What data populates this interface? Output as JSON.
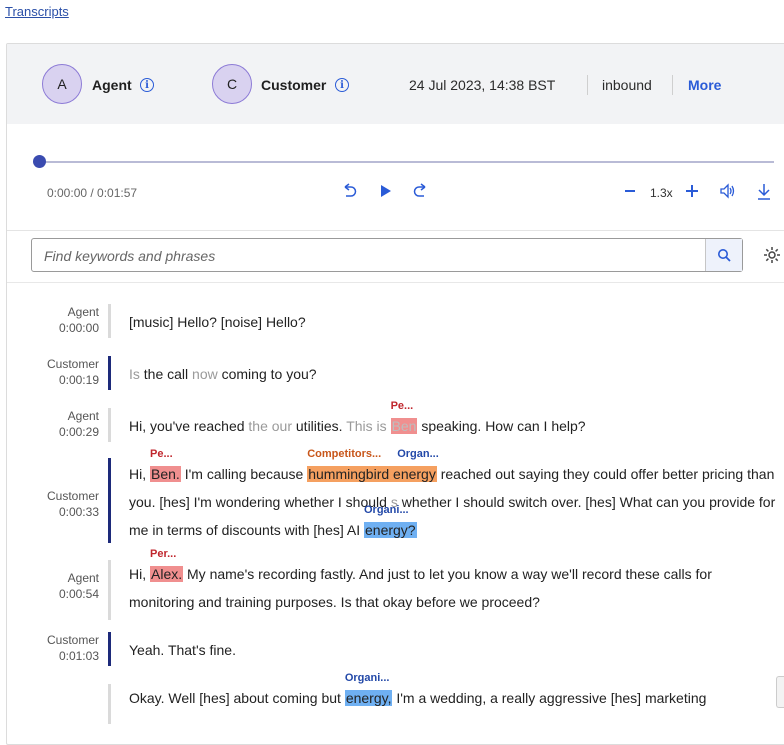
{
  "breadcrumb": "Transcripts",
  "header": {
    "agent": {
      "initial": "A",
      "name": "Agent"
    },
    "customer": {
      "initial": "C",
      "name": "Customer"
    },
    "datetime": "24 Jul 2023, 14:38 BST",
    "direction": "inbound",
    "more_label": "More"
  },
  "player": {
    "time": "0:00:00 / 0:01:57",
    "speed": "1.3x",
    "progress": 0
  },
  "search": {
    "placeholder": "Find keywords and phrases"
  },
  "transcript": [
    {
      "speaker": "Agent",
      "time": "0:00:00"
    },
    {
      "speaker": "Customer",
      "time": "0:00:19"
    },
    {
      "speaker": "Agent",
      "time": "0:00:29"
    },
    {
      "speaker": "Customer",
      "time": "0:00:33"
    },
    {
      "speaker": "Agent",
      "time": "0:00:54"
    },
    {
      "speaker": "Customer",
      "time": "0:01:03"
    }
  ],
  "utterances": {
    "u1": "[music] Hello? [noise] Hello?",
    "u2": {
      "a": "Is",
      "b": " the call ",
      "c": "now",
      "d": " coming to you?"
    },
    "u3": {
      "a": "Hi, you've reached ",
      "b": "the our",
      "c": " utilities. ",
      "d": "This is",
      "e": " ",
      "ent": "Ben",
      "tag": "Pe...",
      "f": " speaking. How can I help?"
    },
    "u4": {
      "a": "Hi, ",
      "ent1": "Ben.",
      "tag1": "Pe...",
      "b": " I'm calling because ",
      "ent2": "hummingbird energy",
      "tag2": "Competitors...",
      "tag2b": "Organ...",
      "c": " reached out saying they could offer better pricing than you. [hes] I'm wondering whether I should ",
      "d": "s",
      "e": " whether I should switch over. [hes] What can you provide for me in terms of discounts with [hes] AI ",
      "ent3": "energy?",
      "tag3": "Organi..."
    },
    "u5": {
      "a": "Hi, ",
      "ent": "Alex.",
      "tag": "Per...",
      "b": " My name's recording fastly. And just to let you know a way we'll record these calls for monitoring and training purposes. Is that okay before we proceed?"
    },
    "u6": "Yeah. That's fine.",
    "u7": {
      "a": "Okay. Well [hes] about coming but ",
      "ent": "energy,",
      "tag": "Organi...",
      "b": " I'm a wedding, a really aggressive [hes] marketing"
    }
  },
  "colors": {
    "accent": "#2a5bd7",
    "person": "#f08f8f",
    "competitor": "#f5a060",
    "organization": "#6fb0f2",
    "customer_bar": "#1d2a7a"
  }
}
